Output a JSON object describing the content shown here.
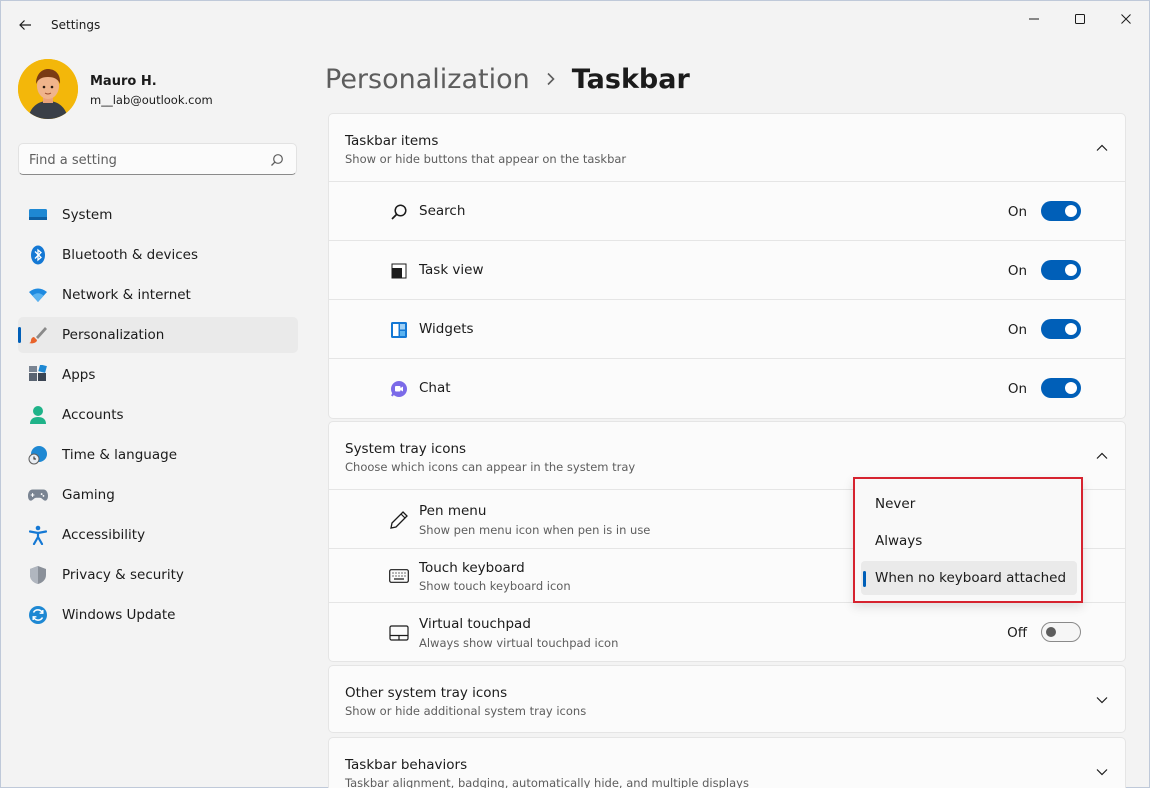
{
  "window": {
    "title": "Settings"
  },
  "user": {
    "name": "Mauro H.",
    "email": "m__lab@outlook.com"
  },
  "search": {
    "placeholder": "Find a setting"
  },
  "nav": {
    "items": [
      {
        "label": "System",
        "icon": "monitor-icon"
      },
      {
        "label": "Bluetooth & devices",
        "icon": "bluetooth-icon"
      },
      {
        "label": "Network & internet",
        "icon": "wifi-icon"
      },
      {
        "label": "Personalization",
        "icon": "brush-icon",
        "active": true
      },
      {
        "label": "Apps",
        "icon": "apps-icon"
      },
      {
        "label": "Accounts",
        "icon": "person-icon"
      },
      {
        "label": "Time & language",
        "icon": "globe-clock-icon"
      },
      {
        "label": "Gaming",
        "icon": "gamepad-icon"
      },
      {
        "label": "Accessibility",
        "icon": "accessibility-icon"
      },
      {
        "label": "Privacy & security",
        "icon": "shield-icon"
      },
      {
        "label": "Windows Update",
        "icon": "update-icon"
      }
    ]
  },
  "breadcrumb": {
    "parent": "Personalization",
    "separator": ">",
    "current": "Taskbar"
  },
  "taskbar_items": {
    "title": "Taskbar items",
    "subtitle": "Show or hide buttons that appear on the taskbar",
    "rows": [
      {
        "label": "Search",
        "state": "On",
        "icon": "search-icon"
      },
      {
        "label": "Task view",
        "state": "On",
        "icon": "task-view-icon"
      },
      {
        "label": "Widgets",
        "state": "On",
        "icon": "widgets-icon"
      },
      {
        "label": "Chat",
        "state": "On",
        "icon": "chat-icon"
      }
    ]
  },
  "system_tray": {
    "title": "System tray icons",
    "subtitle": "Choose which icons can appear in the system tray",
    "rows": [
      {
        "label": "Pen menu",
        "desc": "Show pen menu icon when pen is in use",
        "icon": "pen-icon"
      },
      {
        "label": "Touch keyboard",
        "desc": "Show touch keyboard icon",
        "icon": "keyboard-icon"
      },
      {
        "label": "Virtual touchpad",
        "desc": "Always show virtual touchpad icon",
        "state": "Off",
        "icon": "touchpad-icon"
      }
    ]
  },
  "dropdown": {
    "options": [
      "Never",
      "Always",
      "When no keyboard attached"
    ],
    "selected": "When no keyboard attached",
    "highlight_color": "#d6232f"
  },
  "other_tray": {
    "title": "Other system tray icons",
    "subtitle": "Show or hide additional system tray icons"
  },
  "behaviors": {
    "title": "Taskbar behaviors",
    "subtitle": "Taskbar alignment, badging, automatically hide, and multiple displays"
  },
  "colors": {
    "accent": "#005fb8"
  }
}
